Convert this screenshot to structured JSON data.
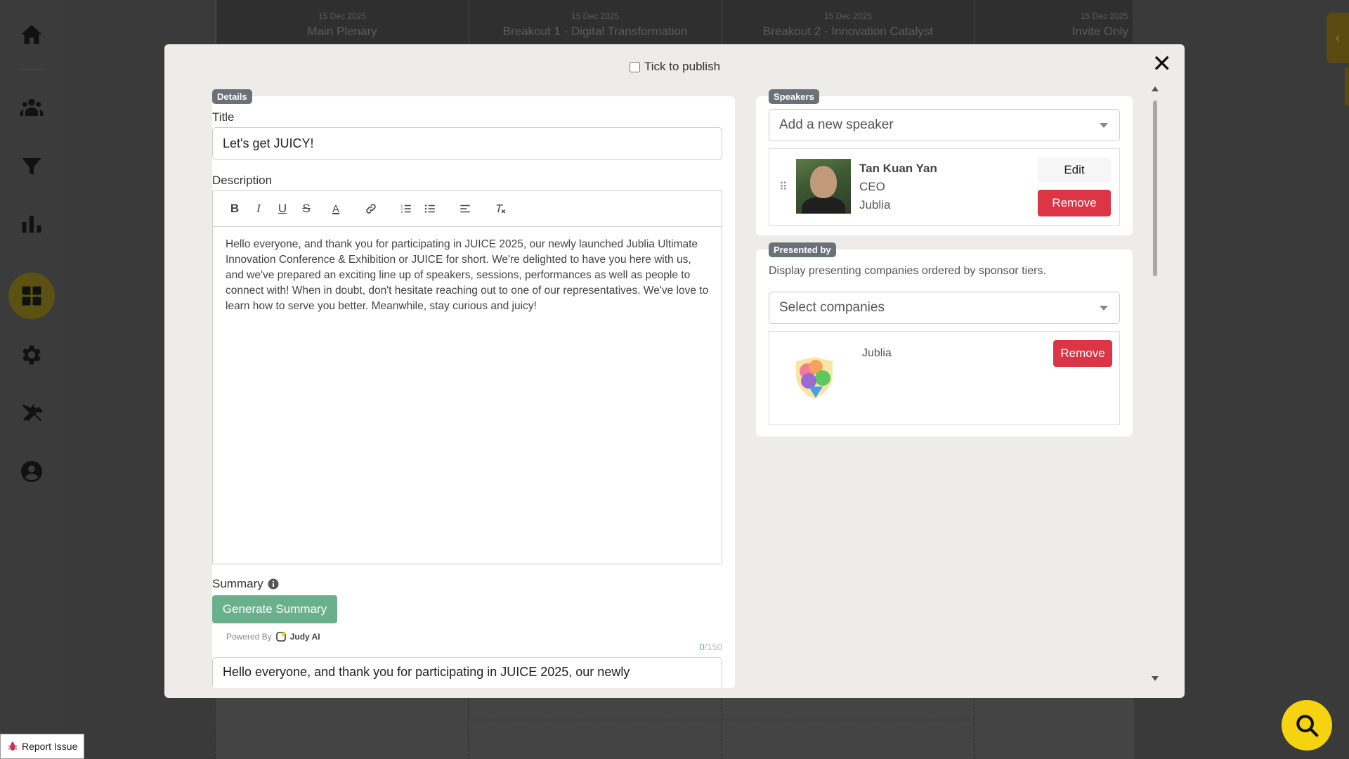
{
  "schedule": {
    "columns": [
      {
        "date": "15 Dec 2025",
        "name": "Main Plenary"
      },
      {
        "date": "15 Dec 2025",
        "name": "Breakout 1 - Digital Transformation"
      },
      {
        "date": "15 Dec 2025",
        "name": "Breakout 2 - Innovation Catalyst"
      },
      {
        "date": "15 Dec 2025",
        "name": "Invite Only"
      }
    ]
  },
  "sidebar": {
    "items": [
      {
        "icon": "home-icon"
      },
      {
        "icon": "people-icon"
      },
      {
        "icon": "filter-icon"
      },
      {
        "icon": "bar-chart-icon"
      },
      {
        "icon": "dashboard-icon",
        "active": true
      },
      {
        "icon": "gear-icon"
      },
      {
        "icon": "tools-icon"
      },
      {
        "icon": "account-icon"
      }
    ]
  },
  "modal": {
    "publish_label": "Tick to publish",
    "close_glyph": "✕",
    "details": {
      "tag": "Details",
      "title_label": "Title",
      "title_value": "Let's get JUICY!",
      "description_label": "Description",
      "description_text": "Hello everyone, and thank you for participating in JUICE 2025, our newly launched Jublia Ultimate Innovation Conference & Exhibition or JUICE for short. We're delighted to have you here with us, and we've prepared an exciting line up of speakers, sessions, performances as well as people to connect with! When in doubt, don't hesitate reaching out to one of our representatives. We've love to learn how to serve you better. Meanwhile, stay curious and juicy!",
      "toolbar": [
        "B",
        "I",
        "U",
        "S",
        "A"
      ],
      "summary_label": "Summary",
      "generate_label": "Generate Summary",
      "powered_by": "Powered By",
      "ai_name": "Judy AI",
      "counter_current": "0",
      "counter_max": "/150",
      "summary_text": "Hello everyone, and thank you for participating in JUICE 2025, our newly"
    },
    "speakers": {
      "tag": "Speakers",
      "placeholder": "Add a new speaker",
      "list": [
        {
          "name": "Tan Kuan Yan",
          "role": "CEO",
          "company": "Jublia",
          "edit_label": "Edit",
          "remove_label": "Remove"
        }
      ]
    },
    "presented_by": {
      "tag": "Presented by",
      "description": "Display presenting companies ordered by sponsor tiers.",
      "placeholder": "Select companies",
      "companies": [
        {
          "name": "Jublia",
          "remove_label": "Remove"
        }
      ]
    }
  },
  "footer": {
    "report_label": "Report Issue"
  },
  "colors": {
    "accent_yellow": "#f5d310",
    "danger": "#dc3545",
    "success": "#6bb08d"
  }
}
